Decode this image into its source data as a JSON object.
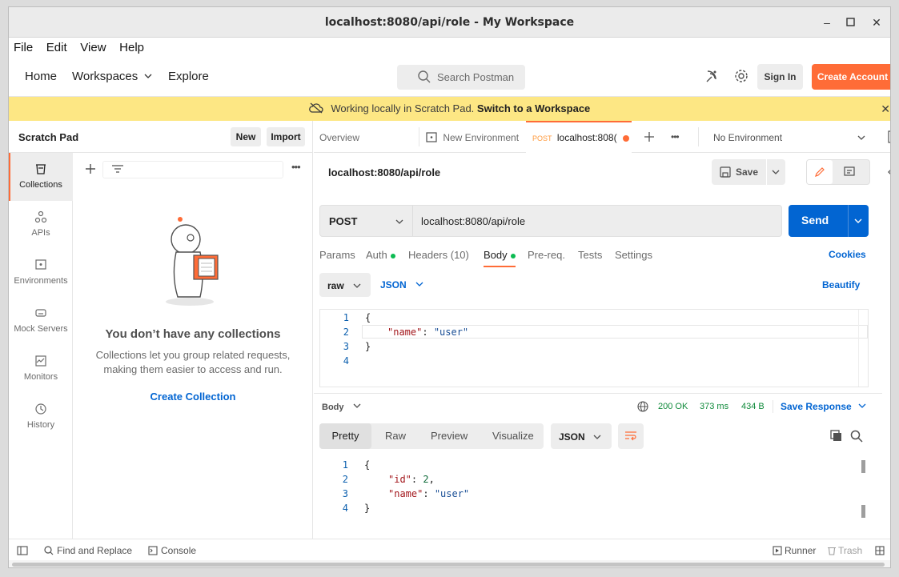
{
  "window": {
    "title": "localhost:8080/api/role - My Workspace"
  },
  "menu": [
    "File",
    "Edit",
    "View",
    "Help"
  ],
  "header": {
    "home": "Home",
    "workspaces": "Workspaces",
    "explore": "Explore",
    "search_placeholder": "Search Postman",
    "sign_in": "Sign In",
    "create_account": "Create Account"
  },
  "banner": {
    "text": "Working locally in Scratch Pad.",
    "link": "Switch to a Workspace"
  },
  "sidebar": {
    "title": "Scratch Pad",
    "new_label": "New",
    "import_label": "Import",
    "items": [
      {
        "label": "Collections",
        "icon": "trash-can-icon"
      },
      {
        "label": "APIs",
        "icon": "apis-icon"
      },
      {
        "label": "Environments",
        "icon": "environment-icon"
      },
      {
        "label": "Mock Servers",
        "icon": "mock-server-icon"
      },
      {
        "label": "Monitors",
        "icon": "monitor-icon"
      },
      {
        "label": "History",
        "icon": "history-icon"
      }
    ]
  },
  "collections": {
    "empty_title": "You don’t have any collections",
    "empty_desc_line1": "Collections let you group related requests,",
    "empty_desc_line2": "making them easier to access and run.",
    "create_link": "Create Collection"
  },
  "tabs": {
    "overview": "Overview",
    "new_env": "New Environment",
    "active_method": "POST",
    "active_label": "localhost:808(",
    "env_select": "No Environment"
  },
  "request": {
    "title": "localhost:8080/api/role",
    "save": "Save",
    "method": "POST",
    "url": "localhost:8080/api/role",
    "send": "Send",
    "tabs": {
      "params": "Params",
      "auth": "Auth",
      "headers": "Headers (10)",
      "body": "Body",
      "prereq": "Pre-req.",
      "tests": "Tests",
      "settings": "Settings"
    },
    "cookies": "Cookies",
    "body_mode": "raw",
    "body_lang": "JSON",
    "beautify": "Beautify",
    "body_lines": {
      "n1": "1",
      "n2": "2",
      "n3": "3",
      "n4": "4",
      "open": "{",
      "key": "\"name\"",
      "colon": ": ",
      "value": "\"user\"",
      "close": "}"
    }
  },
  "response": {
    "label": "Body",
    "status": "200 OK",
    "time": "373 ms",
    "size": "434 B",
    "save_response": "Save Response",
    "view_tabs": {
      "pretty": "Pretty",
      "raw": "Raw",
      "preview": "Preview",
      "visualize": "Visualize"
    },
    "format": "JSON",
    "lines": {
      "n1": "1",
      "n2": "2",
      "n3": "3",
      "n4": "4",
      "open": "{",
      "id_key": "\"id\"",
      "id_val": "2",
      "comma": ",",
      "name_key": "\"name\"",
      "name_val": "\"user\"",
      "colon": ": ",
      "close": "}"
    }
  },
  "footer": {
    "find_replace": "Find and Replace",
    "console": "Console",
    "runner": "Runner",
    "trash": "Trash"
  },
  "colors": {
    "accent": "#ff6c37",
    "primary": "#0265d2",
    "banner": "#fde784",
    "success": "#0cbb52"
  }
}
